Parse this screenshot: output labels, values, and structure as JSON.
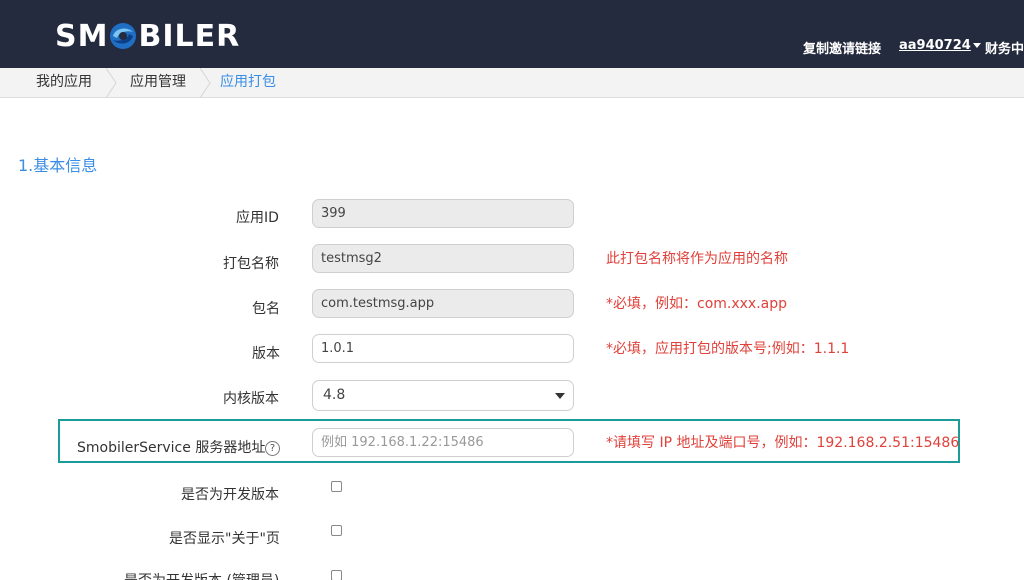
{
  "header": {
    "logo_text_left": "SM",
    "logo_text_right": "BILER",
    "invite_link": "复制邀请链接",
    "username": "aa940724",
    "finance": "财务中"
  },
  "breadcrumb": [
    "我的应用",
    "应用管理",
    "应用打包"
  ],
  "section": {
    "title": "1.基本信息"
  },
  "form": {
    "app_id": {
      "label": "应用ID",
      "value": "399"
    },
    "package_name": {
      "label": "打包名称",
      "value": "testmsg2",
      "hint": "此打包名称将作为应用的名称"
    },
    "bundle": {
      "label": "包名",
      "value": "com.testmsg.app",
      "hint": "*必填，例如：com.xxx.app"
    },
    "version": {
      "label": "版本",
      "value": "1.0.1",
      "hint": "*必填，应用打包的版本号;例如：1.1.1"
    },
    "kernel_version": {
      "label": "内核版本",
      "value": "4.8"
    },
    "service_address": {
      "label": "SmobilerService 服务器地址",
      "placeholder": "例如 192.168.1.22:15486",
      "hint": "*请填写 IP 地址及端口号，例如：192.168.2.51:15486",
      "help": "?"
    },
    "dev_version": {
      "label": "是否为开发版本"
    },
    "show_about": {
      "label": "是否显示\"关于\"页"
    },
    "dev_admin": {
      "label": "是否为开发版本 (管理员)"
    }
  },
  "colors": {
    "nav_bg": "#252b3f",
    "accent": "#3a8ee6",
    "hint": "#e0413a",
    "highlight": "#1b9c99"
  }
}
